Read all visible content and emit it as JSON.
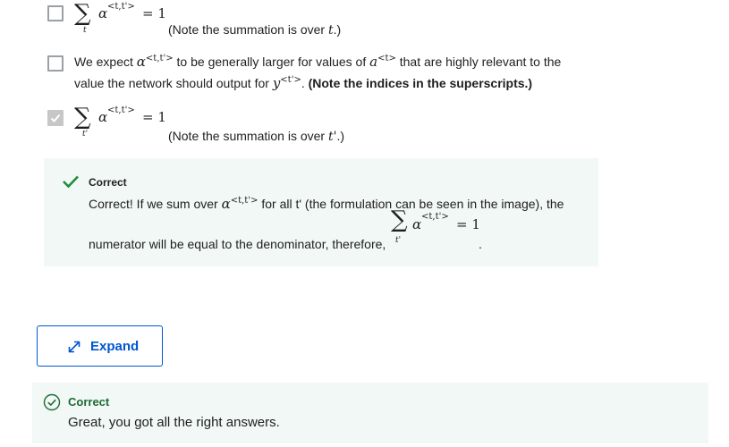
{
  "options": [
    {
      "checked": false,
      "alpha_sup": "<t,t'>",
      "eq": "= 1",
      "sum_sub": "t",
      "note": {
        "prefix": "(Note the summation is over ",
        "var": "t",
        "suffix": ".)"
      }
    },
    {
      "checked": false,
      "line1": {
        "p1": "We expect ",
        "alpha": "α",
        "alpha_sup": "<t,t'>",
        "p2": " to be generally larger for values of ",
        "a": "a",
        "a_sup": "<t>",
        "p3": " that are highly relevant to the"
      },
      "line2": {
        "p1": "value the network should output for ",
        "y": "y",
        "y_sup": "<t'>",
        "p2": ". ",
        "bold": "(Note the indices in the superscripts.)"
      }
    },
    {
      "checked": true,
      "alpha_sup": "<t,t'>",
      "eq": "= 1",
      "sum_sub": "t'",
      "note": {
        "prefix": "(Note the summation is over ",
        "var": "t'",
        "suffix": ".)"
      }
    }
  ],
  "feedback": {
    "title": "Correct",
    "line1_p1": "Correct! If we sum over ",
    "alpha": "α",
    "alpha_sup": "<t,t'>",
    "line1_p2": " for all t' (the formulation can be seen in the image), the",
    "formula_sup": "<t,t'>",
    "formula_eq": "= 1",
    "formula_sub": "t'",
    "line2": "numerator will be equal to the denominator, therefore,",
    "trailing": "."
  },
  "expand_button": {
    "label": "Expand"
  },
  "result": {
    "title": "Correct",
    "message": "Great, you got all the right answers."
  },
  "colors": {
    "accent": "#0056d2",
    "success": "#1e6b35",
    "check_green": "#1e8e3e",
    "feedback_bg": "#f1f8f5"
  }
}
